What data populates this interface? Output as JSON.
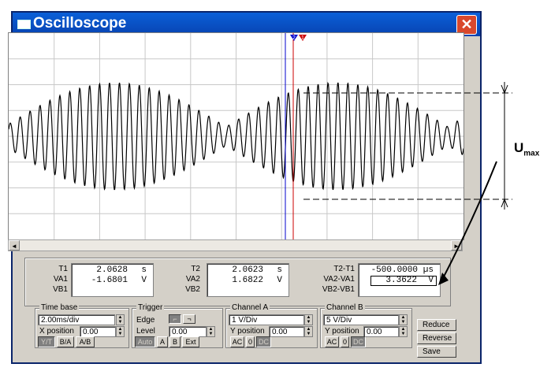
{
  "window": {
    "title": "Oscilloscope",
    "close_glyph": "✕"
  },
  "cursors": {
    "t1_marker": "1",
    "t2_marker": "2"
  },
  "annotation": {
    "label": "U",
    "subscript": "max"
  },
  "readout": {
    "t1": {
      "label": "T1",
      "value": "2.0628",
      "unit": "s"
    },
    "va1": {
      "label": "VA1",
      "value": "-1.6801",
      "unit": "V"
    },
    "vb1": {
      "label": "VB1"
    },
    "t2": {
      "label": "T2",
      "value": "2.0623",
      "unit": "s"
    },
    "va2": {
      "label": "VA2",
      "value": "1.6822",
      "unit": "V"
    },
    "vb2": {
      "label": "VB2"
    },
    "dt": {
      "label": "T2-T1",
      "value": "-500.0000",
      "unit": "µs"
    },
    "dva": {
      "label": "VA2-VA1",
      "value": "3.3622",
      "unit": "V"
    },
    "dvb": {
      "label": "VB2-VB1"
    }
  },
  "timebase": {
    "title": "Time base",
    "value": "2.00ms/div",
    "xpos_label": "X position",
    "xpos": "0.00",
    "modes": [
      "Y/T",
      "B/A",
      "A/B"
    ]
  },
  "trigger": {
    "title": "Trigger",
    "edge_label": "Edge",
    "edge_rise": "⌐",
    "edge_fall": "¬",
    "level_label": "Level",
    "level": "0.00",
    "buttons": [
      "Auto",
      "A",
      "B",
      "Ext"
    ]
  },
  "channel_a": {
    "title": "Channel A",
    "value": "1 V/Div",
    "ypos_label": "Y position",
    "ypos": "0.00",
    "coupling": [
      "AC",
      "0",
      "DC"
    ]
  },
  "channel_b": {
    "title": "Channel B",
    "value": "5 V/Div",
    "ypos_label": "Y position",
    "ypos": "0.00",
    "coupling": [
      "AC",
      "0",
      "DC"
    ]
  },
  "actions": {
    "reduce": "Reduce",
    "reverse": "Reverse",
    "save": "Save"
  },
  "colors": {
    "title_blue": "#0842b0",
    "cursor1": "#cc0000",
    "cursor2": "#0000cc",
    "grid": "#c8c8c8"
  }
}
